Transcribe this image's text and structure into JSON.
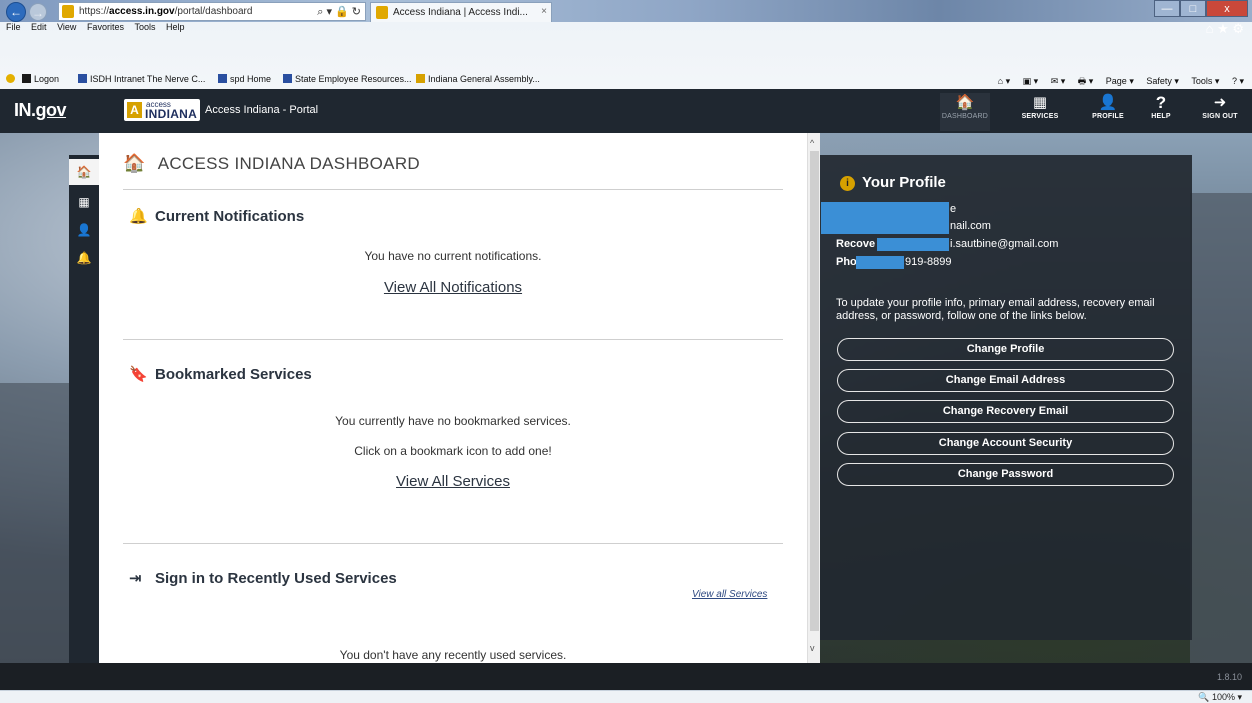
{
  "browser": {
    "url_prefix": "https://",
    "url_domain": "access.in.gov",
    "url_path": "/portal/dashboard",
    "addr_tools": "⌕ ▾ 🔒 ↻",
    "tab_title": "Access Indiana | Access Indi...",
    "tab_close": "×",
    "back": "←",
    "forward": "→",
    "win_min": "—",
    "win_max": "□",
    "win_close": "x",
    "top_right_icons": "⌂ ★ ⚙",
    "menu": [
      "File",
      "Edit",
      "View",
      "Favorites",
      "Tools",
      "Help"
    ],
    "favorites": [
      {
        "label": "Logon",
        "color": "#1a1a1a"
      },
      {
        "label": "ISDH Intranet The Nerve C...",
        "color": "#2a4fa0"
      },
      {
        "label": "spd Home",
        "color": "#2a4fa0"
      },
      {
        "label": "State Employee Resources...",
        "color": "#2a4fa0"
      },
      {
        "label": "Indiana General Assembly...",
        "color": "#d6a100"
      }
    ],
    "command_bar": [
      "⌂ ▾",
      "▣ ▾",
      "✉ ▾",
      "🖶 ▾",
      "Page ▾",
      "Safety ▾",
      "Tools ▾",
      "? ▾"
    ],
    "zoom": "🔍 100%  ▾"
  },
  "header": {
    "ingov_in": "IN.",
    "ingov_gov": "gov",
    "access_small": "access",
    "access_big": "INDIANA",
    "access_a": "A",
    "portal_title": "Access Indiana - Portal",
    "nav": [
      {
        "label": "DASHBOARD",
        "icon": "🏠"
      },
      {
        "label": "SERVICES",
        "icon": "▦"
      },
      {
        "label": "PROFILE",
        "icon": "👤"
      },
      {
        "label": "HELP",
        "icon": "?"
      },
      {
        "label": "SIGN OUT",
        "icon": "➜"
      }
    ]
  },
  "rail": {
    "home": "🏠",
    "services": "▦",
    "profile": "👤",
    "notifications": "🔔"
  },
  "main": {
    "title": "ACCESS INDIANA DASHBOARD",
    "title_icon": "🏠",
    "notifications": {
      "icon": "🔔",
      "title": "Current Notifications",
      "empty": "You have no current notifications.",
      "link": "View All Notifications"
    },
    "bookmarks": {
      "icon": "🔖",
      "title": "Bookmarked Services",
      "empty": "You currently have no bookmarked services.",
      "hint": "Click on a bookmark icon to add one!",
      "link": "View All Services"
    },
    "recent": {
      "icon": "⇥",
      "title": "Sign in to Recently Used Services",
      "link": "View all Services",
      "empty": "You don't have any recently used services."
    }
  },
  "profile": {
    "title": "Your Profile",
    "info_icon": "i",
    "line1": "e",
    "line2": "nail.com",
    "recovery_label": "Recove",
    "recovery_value": "i.sautbine@gmail.com",
    "phone_label": "Pho",
    "phone_value": "919-8899",
    "message": "To update your profile info, primary email address, recovery email address, or password, follow one of the links below.",
    "buttons": [
      "Change Profile",
      "Change Email Address",
      "Change Recovery Email",
      "Change Account Security",
      "Change Password"
    ],
    "redaction_color": "#3b8fd6"
  },
  "footer": {
    "version": "1.8.10"
  }
}
